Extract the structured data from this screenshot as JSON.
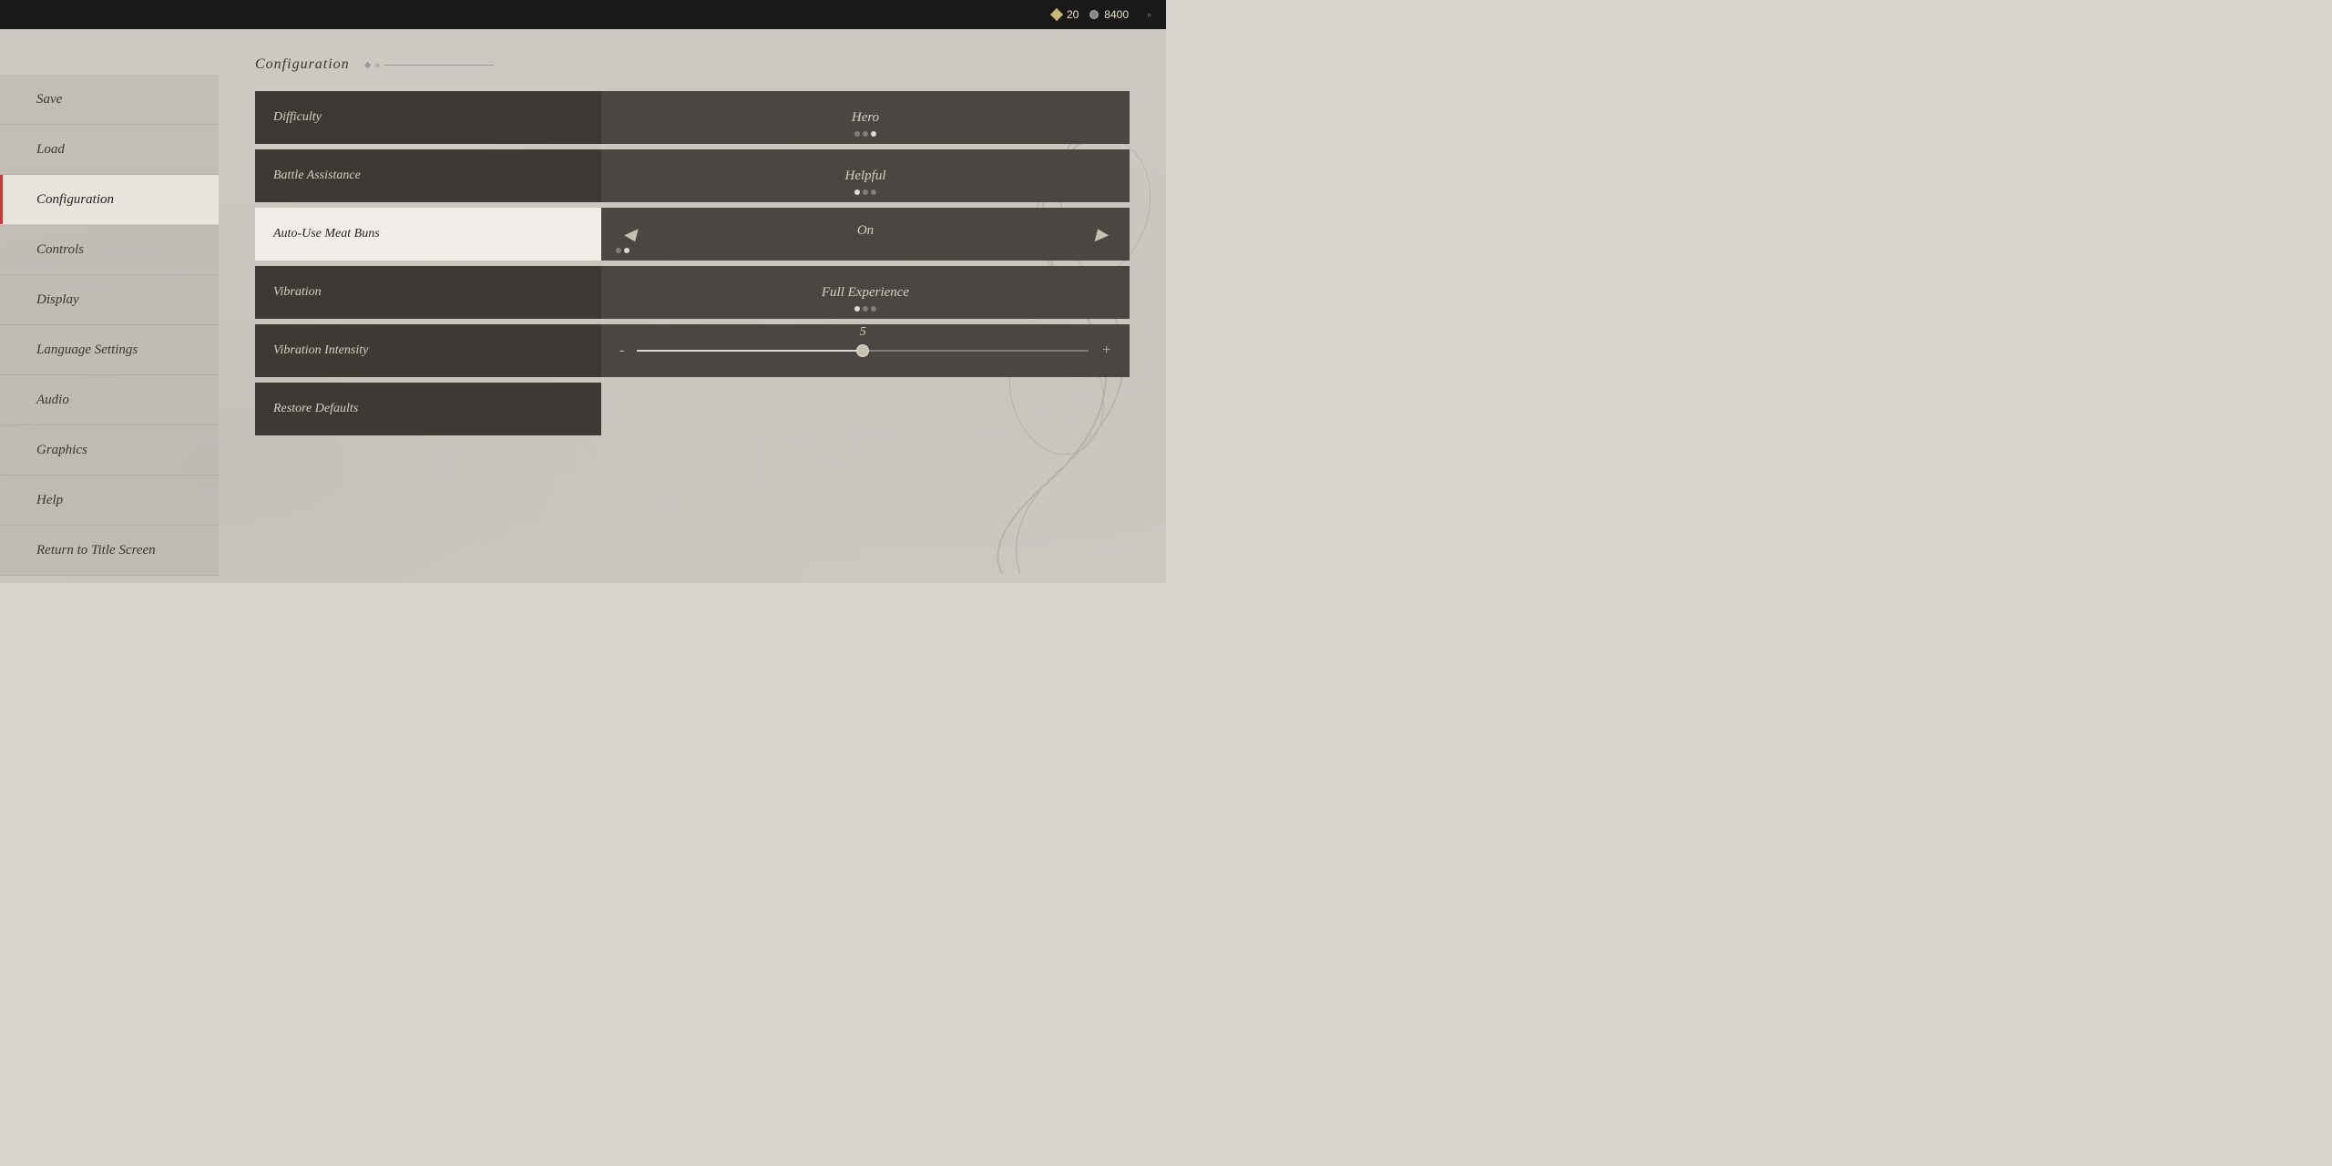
{
  "topBar": {
    "diamond_count": "20",
    "circle_count": "8400"
  },
  "sidebar": {
    "items": [
      {
        "id": "save",
        "label": "Save",
        "active": false
      },
      {
        "id": "load",
        "label": "Load",
        "active": false
      },
      {
        "id": "configuration",
        "label": "Configuration",
        "active": true
      },
      {
        "id": "controls",
        "label": "Controls",
        "active": false
      },
      {
        "id": "display",
        "label": "Display",
        "active": false
      },
      {
        "id": "language-settings",
        "label": "Language Settings",
        "active": false
      },
      {
        "id": "audio",
        "label": "Audio",
        "active": false
      },
      {
        "id": "graphics",
        "label": "Graphics",
        "active": false
      },
      {
        "id": "help",
        "label": "Help",
        "active": false
      },
      {
        "id": "return-to-title",
        "label": "Return to Title Screen",
        "active": false
      }
    ]
  },
  "mainContent": {
    "title": "Configuration",
    "settings": [
      {
        "id": "difficulty",
        "label": "Difficulty",
        "value": "Hero",
        "type": "indicator",
        "dots": [
          false,
          false,
          true
        ]
      },
      {
        "id": "battle-assistance",
        "label": "Battle Assistance",
        "value": "Helpful",
        "type": "indicator",
        "dots": [
          true,
          false,
          false
        ]
      },
      {
        "id": "auto-use-meat-buns",
        "label": "Auto-Use Meat Buns",
        "value": "On",
        "type": "arrows",
        "selected": true,
        "dots": [
          false,
          true
        ]
      },
      {
        "id": "vibration",
        "label": "Vibration",
        "value": "Full Experience",
        "type": "indicator",
        "dots": [
          true,
          false,
          false
        ]
      },
      {
        "id": "vibration-intensity",
        "label": "Vibration Intensity",
        "value": "5",
        "type": "slider",
        "sliderPercent": 50,
        "min_label": "-",
        "max_label": "+"
      }
    ],
    "restore_defaults": {
      "label": "Restore Defaults"
    }
  },
  "icons": {
    "arrow_left": "◀",
    "arrow_right": "▶",
    "diamond": "◆",
    "expand": "»"
  }
}
